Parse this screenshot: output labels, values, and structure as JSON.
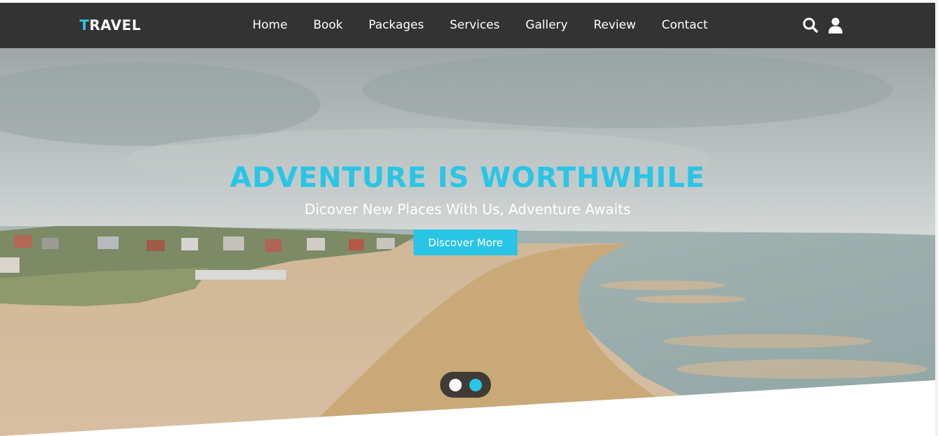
{
  "brand": {
    "first_letter": "T",
    "rest": "RAVEL"
  },
  "nav": {
    "items": [
      "Home",
      "Book",
      "Packages",
      "Services",
      "Gallery",
      "Review",
      "Contact"
    ],
    "icons": [
      "search-icon",
      "user-icon"
    ]
  },
  "hero": {
    "title": "ADVENTURE IS WORTHWHILE",
    "subtitle": "Dicover New Places With Us, Adventure Awaits",
    "button_label": "Discover More",
    "slides": 2,
    "active_slide": 2
  },
  "colors": {
    "accent": "#29c5e6",
    "navbar": "#333333",
    "text_light": "#ffffff"
  }
}
